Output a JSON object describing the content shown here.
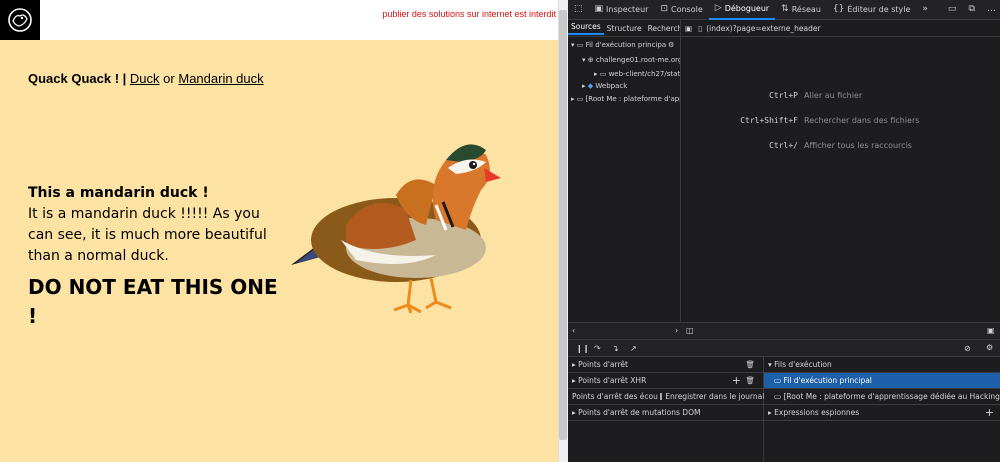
{
  "page": {
    "warning": "publier des solutions sur internet est interdit",
    "nav": {
      "brand": "Quack Quack ! |",
      "link1": "Duck",
      "sep": "or",
      "link2": "Mandarin duck"
    },
    "heading": "This a mandarin duck !",
    "paragraph": "It is a mandarin duck !!!!! As you can see, it is much more beautiful than a normal duck.",
    "shout": "DO NOT EAT THIS ONE !"
  },
  "devtools": {
    "tabs": [
      {
        "icon": "inspector-icon",
        "label": "Inspecteur"
      },
      {
        "icon": "console-icon",
        "label": "Console"
      },
      {
        "icon": "debugger-icon",
        "label": "Débogueur"
      },
      {
        "icon": "network-icon",
        "label": "Réseau"
      },
      {
        "icon": "style-editor-icon",
        "label": "Éditeur de style"
      }
    ],
    "subtabs": [
      "Sources",
      "Structure",
      "Recherch"
    ],
    "tree": [
      "Fil d'exécution principa",
      "challenge01.root-me.org",
      "web-client/ch27/stat",
      "Webpack",
      "[Root Me : plateforme d'app"
    ],
    "file": "(index)?page=externe_header",
    "shortcuts": [
      {
        "key": "Ctrl+P",
        "label": "Aller au fichier"
      },
      {
        "key": "Ctrl+Shift+F",
        "label": "Rechercher dans des fichiers"
      },
      {
        "key": "Ctrl+/",
        "label": "Afficher tous les raccourcis"
      }
    ],
    "breakpoints": {
      "bp": "Points d'arrêt",
      "xhr": "Points d'arrêt XHR",
      "listeners": "Points d'arrêt des écou",
      "log": "Enregistrer dans le journal",
      "dom": "Points d'arrêt de mutations DOM"
    },
    "threads": {
      "title": "Fils d'exécution",
      "main": "Fil d'exécution principal",
      "other": "[Root Me : plateforme d'apprentissage dédiée au Hacking et à l...",
      "watch": "Expressions espionnes"
    },
    "colors": {
      "accent": "#1a8cff",
      "selected": "#1d5fa8",
      "warning": "#dd1111"
    }
  }
}
